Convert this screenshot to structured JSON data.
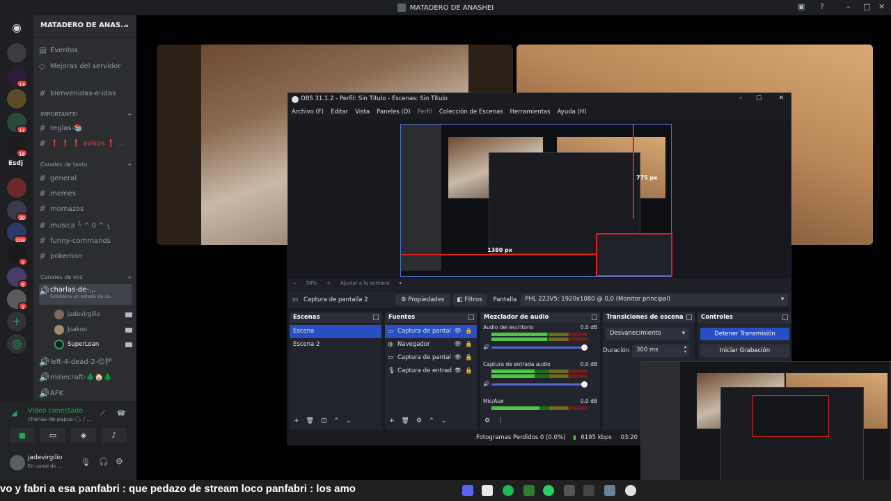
{
  "window": {
    "title": "MATADERO DE ANASHEI"
  },
  "server": {
    "name": "MATADERO DE ANAS...",
    "badges": [
      "13",
      "11",
      "16",
      "30",
      "204",
      "1",
      "8",
      "1"
    ],
    "rail_label": "Esdj"
  },
  "channels": {
    "top": [
      {
        "label": "Eventos",
        "icon": "calendar-icon"
      },
      {
        "label": "Mejoras del servidor",
        "icon": "boost-icon"
      },
      {
        "label": "bienvenidas-e-idas",
        "icon": "hash-icon"
      }
    ],
    "cat_important": "IMPORTANTE!",
    "important": [
      "reglas-📚",
      "❗ ❗ ❗ avisos ❗ ..."
    ],
    "cat_text": "Canales de texto",
    "text": [
      "general",
      "memes",
      "momazos",
      "musica └ ^ 0 ^ ┐",
      "funny-commands",
      "pokemon"
    ],
    "cat_voice": "Canales de voz",
    "voice_active": {
      "label": "charlas-de-...",
      "status": "Establece un estado de ca..."
    },
    "voice_users": [
      "jadevirgilio",
      "Joakoo",
      "SuperLoan"
    ],
    "voice_other": [
      "left-4-dead-2-😊🏴",
      "minecraft-🌲🏠🌲",
      "AFK"
    ]
  },
  "voice_panel": {
    "status": "Video conectado",
    "channel": "charlas-de-papus-🗣 / ..."
  },
  "user_panel": {
    "username": "jadevirgilio",
    "sub": "En canal de ..."
  },
  "obs": {
    "title": "OBS 31.1.2 - Perfil: Sin Título - Escenas: Sin Título",
    "menu": [
      "Archivo (F)",
      "Editar",
      "Vista",
      "Paneles (D)",
      "Perfil",
      "Colección de Escenas",
      "Herramientas",
      "Ayuda (H)"
    ],
    "preview_labels": {
      "height": "775 px",
      "width": "1380 px"
    },
    "toolbar": {
      "zoom": "30%",
      "fit": "Ajustar a la ventana"
    },
    "source_bar": {
      "source": "Captura de pantalla 2",
      "properties": "Propiedades",
      "filters": "Filtros",
      "display_label": "Pantalla",
      "display_value": "PHL 223V5: 1920x1080 @ 0,0 (Monitor principal)"
    },
    "scenes": {
      "header": "Escenas",
      "items": [
        "Escena",
        "Escena 2"
      ]
    },
    "sources": {
      "header": "Fuentes",
      "items": [
        "Captura de pantal",
        "Navegador",
        "Captura de pantal",
        "Captura de entrad"
      ]
    },
    "mixer": {
      "header": "Mezclador de audio",
      "channels": [
        {
          "name": "Audio del escritorio",
          "db": "0.0 dB",
          "level": 0.58
        },
        {
          "name": "Captura de entrada audio",
          "db": "0.0 dB",
          "level": 0.45
        },
        {
          "name": "Mic/Aux",
          "db": "0.0 dB",
          "level": 0.5
        }
      ],
      "scale": "-60 -55 -50 -45 -40 -35 -30 -25 -20 -15 -10 -5 0"
    },
    "transitions": {
      "header": "Transiciones de escena",
      "type": "Desvanecimiento",
      "duration_label": "Duración",
      "duration": "300 ms"
    },
    "controls": {
      "header": "Controles",
      "stop_stream": "Detener Transmisión",
      "start_record": "Iniciar Grabación"
    },
    "status": {
      "dropped": "Fotogramas Perdidos 0 (0.0%)",
      "bitrate": "6195 kbps",
      "time": "03:20"
    }
  },
  "ticker": "vo y fabri a esa  panfabri : que pedazo de stream loco  panfabri : los amo",
  "colors": {
    "obs_accent": "#284ec3",
    "discord_green": "#23a559",
    "badge_red": "#f23f43"
  }
}
